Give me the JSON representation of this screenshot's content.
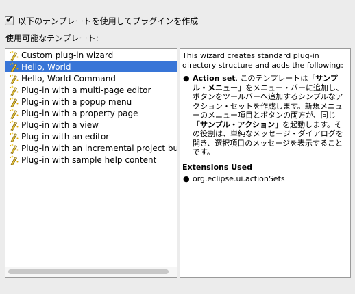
{
  "option": {
    "checked": true,
    "label": "以下のテンプレートを使用してプラグインを作成"
  },
  "templates_label": "使用可能なテンプレート:",
  "templates": [
    {
      "label": "Custom plug-in wizard",
      "selected": false
    },
    {
      "label": "Hello, World",
      "selected": true
    },
    {
      "label": "Hello, World Command",
      "selected": false
    },
    {
      "label": "Plug-in with a multi-page editor",
      "selected": false
    },
    {
      "label": "Plug-in with a popup menu",
      "selected": false
    },
    {
      "label": "Plug-in with a property page",
      "selected": false
    },
    {
      "label": "Plug-in with a view",
      "selected": false
    },
    {
      "label": "Plug-in with an editor",
      "selected": false
    },
    {
      "label": "Plug-in with an incremental project builder",
      "selected": false
    },
    {
      "label": "Plug-in with sample help content",
      "selected": false
    }
  ],
  "description": {
    "intro": "This wizard creates standard plug-in directory structure and adds the following:",
    "item_title": "Action set",
    "item_text_1": ". このテンプレートは「",
    "item_bold_1": "サンプル・メニュー",
    "item_text_2": "」をメニュー・バーに追加し、ボタンをツールバーへ追加するシンプルなアクション・セットを作成します。新規メニューのメニュー項目とボタンの両方が、同じ「",
    "item_bold_2": "サンプル・アクション",
    "item_text_3": "」を起動します。その役割は、単純なメッセージ・ダイアログを開き、選択項目のメッセージを表示することです。",
    "extensions_heading": "Extensions Used",
    "extension": "org.eclipse.ui.actionSets",
    "bullet": "●"
  },
  "icons": {
    "checkbox": "checkmark-icon",
    "template": "wizard-wand-icon"
  },
  "colors": {
    "selection": "#3875d7",
    "background": "#ececec"
  }
}
